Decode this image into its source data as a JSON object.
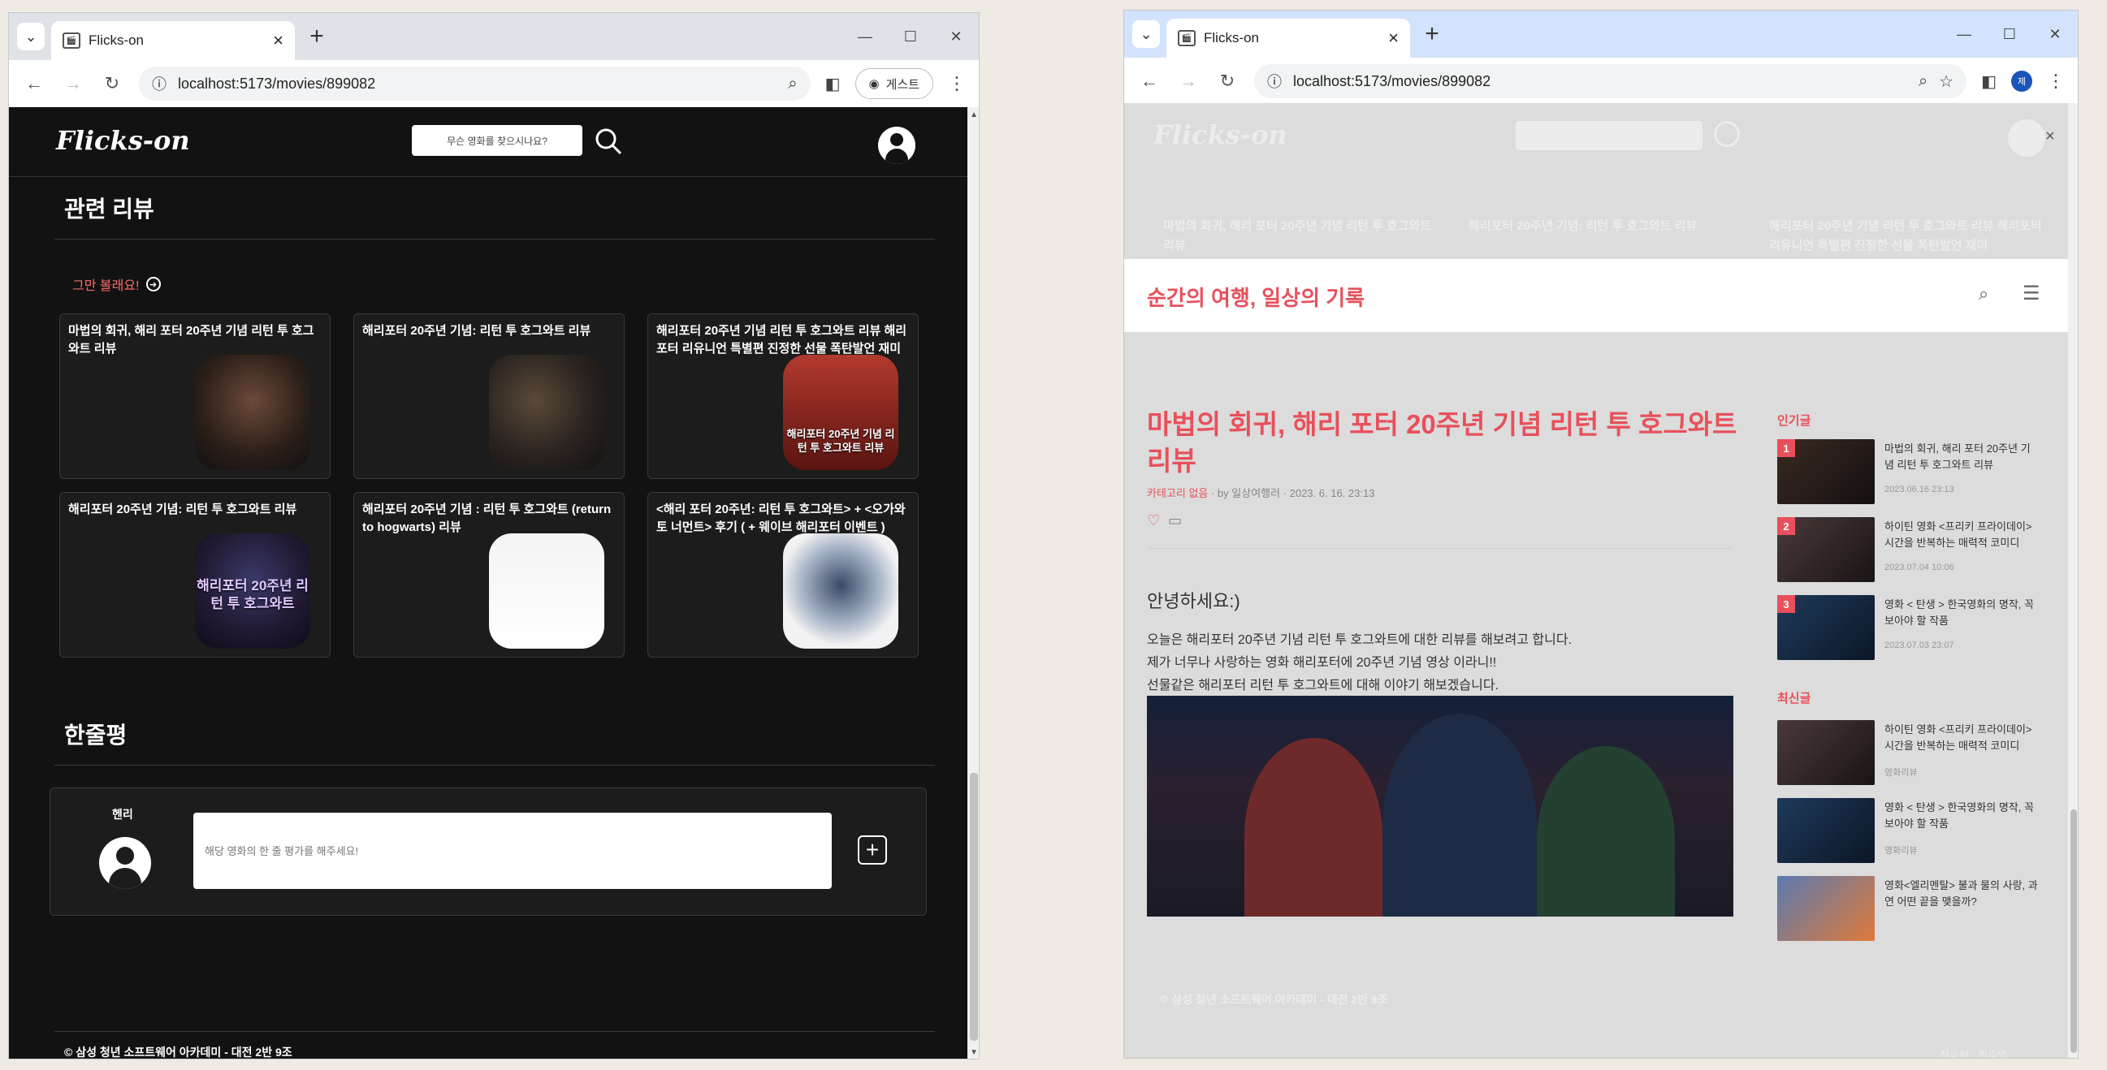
{
  "left": {
    "tab_title": "Flicks-on",
    "url": "localhost:5173/movies/899082",
    "guest_label": "게스트",
    "site": {
      "logo": "Flicks-on",
      "search_placeholder": "무슨 영화를 찾으시나요?"
    },
    "related_reviews_title": "관련 리뷰",
    "stop_label": "그만 볼래요!",
    "reviews": [
      {
        "title": "마법의 회귀, 해리 포터 20주년 기념 리턴 투 호그와트 리뷰",
        "thumb_text": ""
      },
      {
        "title": "해리포터 20주년 기념: 리턴 투 호그와트 리뷰",
        "thumb_text": ""
      },
      {
        "title": "해리포터 20주년 기념 리턴 투 호그와트 리뷰 해리포터 리유니언 특별편 진정한 선물 폭탄발언 재미",
        "thumb_text": "해리포터 20주년 기념 리턴 투 호그와트 리뷰"
      },
      {
        "title": "해리포터 20주년 기념: 리턴 투 호그와트 리뷰",
        "thumb_text": "해리포터 20주년 리턴 투 호그와트"
      },
      {
        "title": "해리포터 20주년 기념 : 리턴 투 호그와트 (return to hogwarts) 리뷰",
        "thumb_text": ""
      },
      {
        "title": "<해리 포터 20주년: 리턴 투 호그와트> + <오가와 토 너먼트> 후기 ( + 웨이브 해리포터 이벤트 )",
        "thumb_text": ""
      }
    ],
    "oneline_title": "한줄평",
    "comment": {
      "username": "헨리",
      "placeholder": "해당 영화의 한 줄 평가를 해주세요!"
    },
    "footer": "© 삼성 청년 소프트웨어 아카데미 - 대전 2반 9조"
  },
  "right": {
    "tab_title": "Flicks-on",
    "url": "localhost:5173/movies/899082",
    "profile_initial": "제",
    "dim_texts": [
      "마법의 회귀, 해리 포터 20주년 기념 리턴 투 호그와트 리뷰",
      "해리포터 20주년 기념: 리턴 투 호그와트 리뷰",
      "해리포터 20주년 기념 리턴 투 호그와트 리뷰 해리포터 리유니언 특별편 진정한 선물 폭탄발언 재미"
    ],
    "blog_title": "순간의 여행, 일상의 기록",
    "post": {
      "title": "마법의 회귀, 해리 포터 20주년 기념 리턴 투 호그와트 리뷰",
      "category": "카테고리 없음",
      "meta_rest": " · by 일상여행러 · 2023. 6. 16. 23:13",
      "greeting": "안녕하세요:)",
      "body_lines": [
        "오늘은 해리포터 20주년 기념 리턴 투 호그와트에 대한 리뷰를 해보려고 합니다.",
        "제가 너무나 사랑하는 영화 해리포터에 20주년 기념 영상 이라니!!",
        "선물같은 해리포터 리턴 투 호그와트에 대해 이야기 해보겠습니다."
      ]
    },
    "popular_label": "인기글",
    "popular": [
      {
        "rank": "1",
        "title": "마법의 회귀, 해리 포터 20주년 기념 리턴 투 호그와트 리뷰",
        "sub": "2023.06.16 23:13"
      },
      {
        "rank": "2",
        "title": "하이틴 영화 <프리키 프라이데이> 시간을 반복하는 매력적 코미디",
        "sub": "2023.07.04 10:06"
      },
      {
        "rank": "3",
        "title": "영화 < 탄생 > 한국영화의 명작, 꼭 보아야 할 작품",
        "sub": "2023.07.03 23:07"
      }
    ],
    "latest_label": "최신글",
    "latest": [
      {
        "title": "하이틴 영화 <프리키 프라이데이> 시간을 반복하는 매력적 코미디",
        "sub": "영화리뷰"
      },
      {
        "title": "영화 < 탄생 > 한국영화의 명작, 꼭 보아야 할 작품",
        "sub": "영화리뷰"
      },
      {
        "title": "영화<엘리멘탈> 불과 물의 사랑, 과연 어떤 끝을 맺을까?",
        "sub": ""
      }
    ],
    "footer": "© 삼성 청년 소프트웨어 아카데미 - 대전 2반 9조",
    "footer2": "전승헌 · 한수영"
  },
  "colors": {
    "accent_red": "#e8505b",
    "site_bg": "#121212",
    "card_bg": "#1c1c1c"
  }
}
